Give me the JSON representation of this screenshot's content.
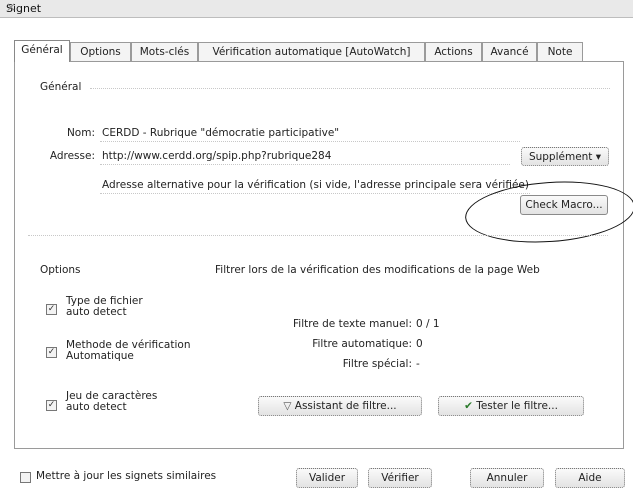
{
  "window": {
    "title": "Signet",
    "close_glyph": "×"
  },
  "tabs": [
    {
      "label": "Général"
    },
    {
      "label": "Options"
    },
    {
      "label": "Mots-clés"
    },
    {
      "label": "Vérification automatique [AutoWatch]"
    },
    {
      "label": "Actions"
    },
    {
      "label": "Avancé"
    },
    {
      "label": "Note"
    }
  ],
  "general": {
    "section_label": "Général",
    "name_label": "Nom:",
    "name_value": "CERDD - Rubrique \"démocratie participative\"",
    "address_label": "Adresse:",
    "address_value": "http://www.cerdd.org/spip.php?rubrique284",
    "supplement_button": "Supplément ▾",
    "alt_address_text": "Adresse alternative pour la vérification (si vide, l'adresse principale sera vérifiée)",
    "check_macro_button": "Check Macro..."
  },
  "options": {
    "section_label": "Options",
    "filter_heading": "Filtrer lors de la vérification des modifications de la page Web",
    "checkboxes": [
      {
        "line1": "Type de fichier",
        "line2": "auto detect",
        "checked": true
      },
      {
        "line1": "Methode de vérification",
        "line2": "Automatique",
        "checked": true
      },
      {
        "line1": "Jeu de caractères",
        "line2": "auto detect",
        "checked": true
      }
    ],
    "filters": [
      {
        "label": "Filtre de texte manuel:",
        "value": "0 / 1"
      },
      {
        "label": "Filtre automatique:",
        "value": "0"
      },
      {
        "label": "Filtre spécial:",
        "value": "-"
      }
    ],
    "assistant_button": "Assistant de filtre...",
    "test_button": "Tester le filtre..."
  },
  "footer": {
    "update_similar_label": "Mettre à jour les signets similaires",
    "validate_button": "Valider",
    "verify_button": "Vérifier",
    "cancel_button": "Annuler",
    "help_button": "Aide"
  }
}
